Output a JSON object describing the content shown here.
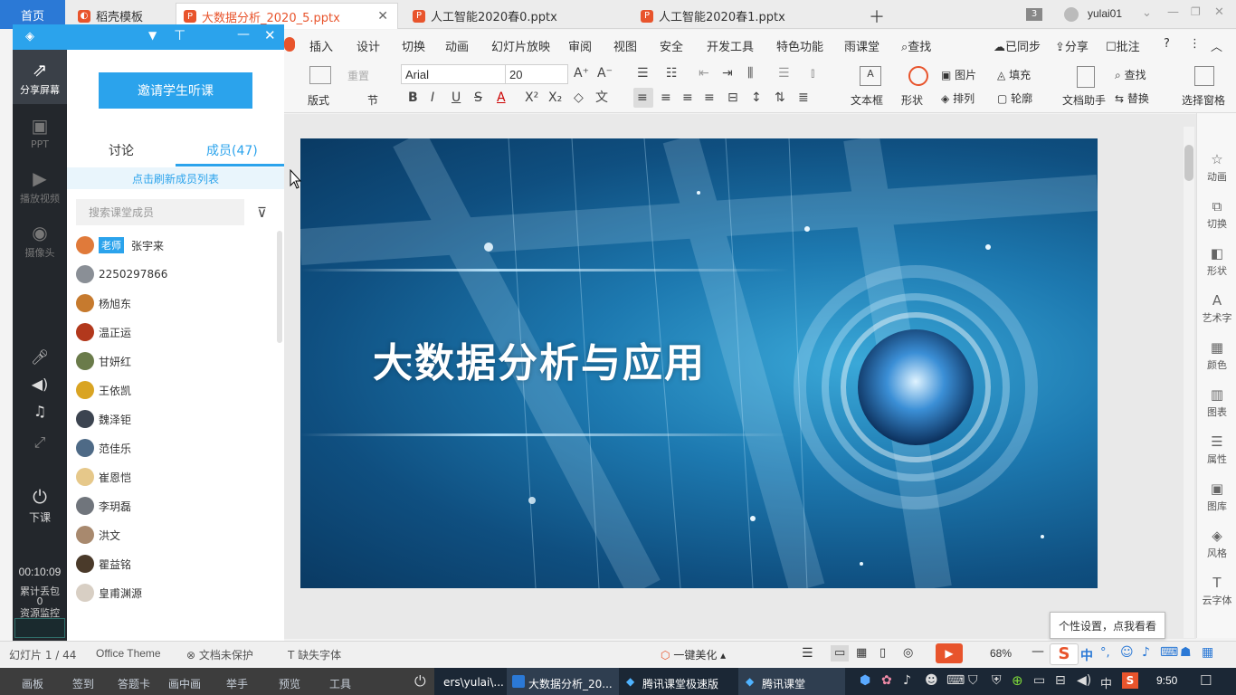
{
  "tabs": [
    {
      "label": "首页"
    },
    {
      "label": "稻壳模板"
    },
    {
      "label": "大数据分析_2020_5.pptx"
    },
    {
      "label": "人工智能2020春0.pptx"
    },
    {
      "label": "人工智能2020春1.pptx"
    }
  ],
  "window": {
    "badge": "3",
    "user": "yulai01"
  },
  "menu": {
    "items": [
      "插入",
      "设计",
      "切换",
      "动画",
      "幻灯片放映",
      "审阅",
      "视图",
      "安全",
      "开发工具",
      "特色功能",
      "雨课堂"
    ],
    "search": "查找",
    "synced": "已同步",
    "share": "分享",
    "annotate": "批注"
  },
  "ribbon": {
    "reset": "重置",
    "layout": "版式",
    "section": "节",
    "font": "Arial",
    "size": "20",
    "textbox": "文本框",
    "shape": "形状",
    "picture": "图片",
    "arrange": "排列",
    "fill": "填充",
    "outline": "轮廓",
    "doc_helper": "文档助手",
    "find": "查找",
    "replace": "替换",
    "select_pane": "选择窗格"
  },
  "right_panel": [
    "动画",
    "切换",
    "形状",
    "艺术字",
    "颜色",
    "图表",
    "属性",
    "图库",
    "风格",
    "云字体"
  ],
  "slide": {
    "title": "大数据分析与应用"
  },
  "status": {
    "slide_no": "幻灯片 1 / 44",
    "theme": "Office Theme",
    "protect": "文档未保护",
    "font_missing": "缺失字体",
    "beautify": "一键美化",
    "zoom": "68%",
    "tooltip": "个性设置，点我看看"
  },
  "classroom": {
    "side": {
      "share": "分享屏幕",
      "ppt": "PPT",
      "video": "播放视频",
      "camera": "摄像头",
      "end": "下课",
      "timer": "00:10:09",
      "loss": "累计丢包",
      "loss_val": "0",
      "monitor": "资源监控"
    },
    "invite": "邀请学生听课",
    "tab_discuss": "讨论",
    "tab_members": "成员(47)",
    "refresh": "点击刷新成员列表",
    "search_placeholder": "搜索课堂成员",
    "teacher_tag": "老师",
    "members": [
      "张宇来",
      "2250297866",
      "杨旭东",
      "温正运",
      "甘妍红",
      "王依凯",
      "魏泽钜",
      "范佳乐",
      "崔恩恺",
      "李玥磊",
      "洪文",
      "瞿益铭",
      "皇甫渊源"
    ]
  },
  "taskbar": {
    "items": [
      "画板",
      "签到",
      "答题卡",
      "画中画",
      "举手",
      "预览",
      "工具"
    ],
    "path": "ers\\yulai\\...",
    "apps": [
      "大数据分析_20...",
      "腾讯课堂极速版",
      "腾讯课堂"
    ],
    "ime": "中",
    "time": "9:50"
  },
  "colors": {
    "accent": "#2ba3ec",
    "wps_red": "#e8542c",
    "dark_panel": "#23272c",
    "taskbar": "#1b2735"
  }
}
